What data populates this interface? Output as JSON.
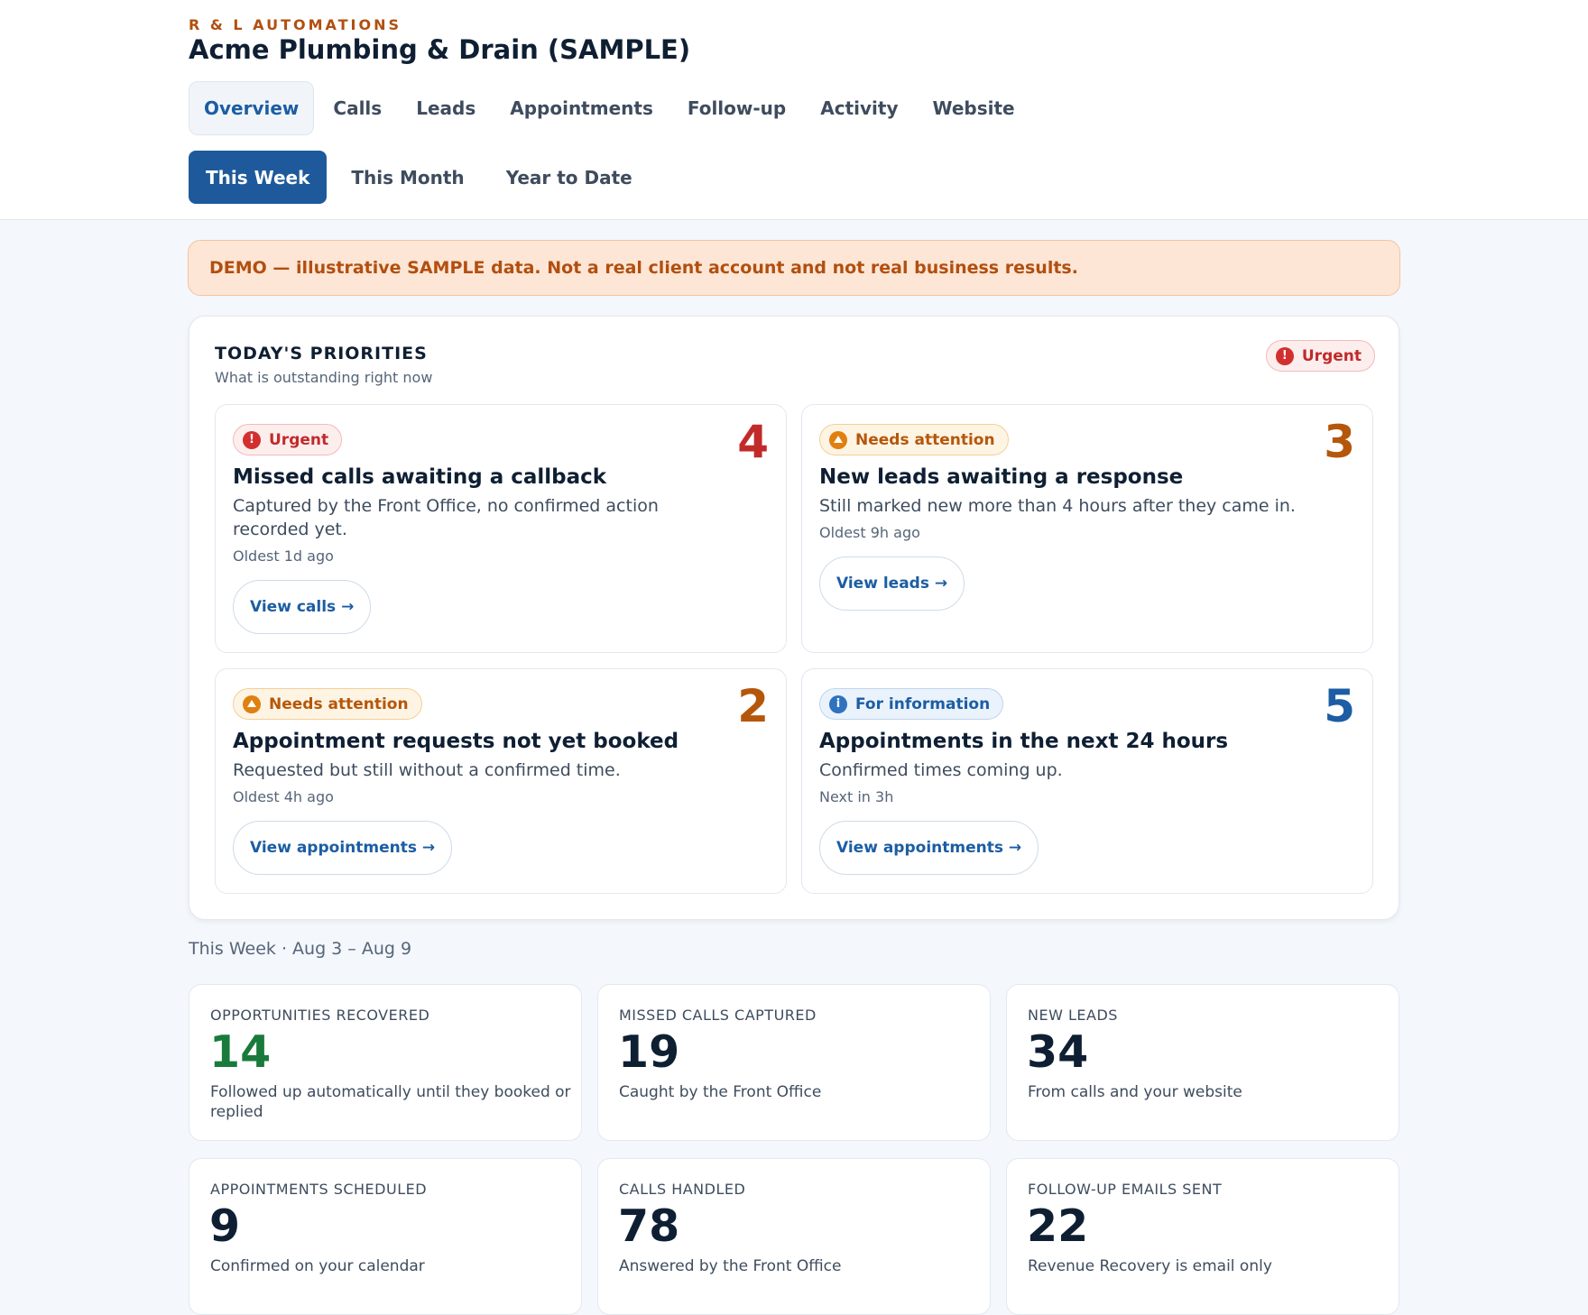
{
  "header": {
    "brand": "R & L AUTOMATIONS",
    "client": "Acme Plumbing & Drain (SAMPLE)",
    "tabs": [
      {
        "label": "Overview",
        "active": true
      },
      {
        "label": "Calls"
      },
      {
        "label": "Leads"
      },
      {
        "label": "Appointments"
      },
      {
        "label": "Follow-up"
      },
      {
        "label": "Activity"
      },
      {
        "label": "Website"
      }
    ],
    "ranges": [
      {
        "label": "This Week",
        "active": true
      },
      {
        "label": "This Month"
      },
      {
        "label": "Year to Date"
      }
    ]
  },
  "demo_banner": "DEMO — illustrative SAMPLE data. Not a real client account and not real business results.",
  "priorities": {
    "title": "TODAY'S PRIORITIES",
    "subtitle": "What is outstanding right now",
    "badge": "Urgent",
    "cards": [
      {
        "badge": "Urgent",
        "count": "4",
        "title": "Missed calls awaiting a callback",
        "desc": "Captured by the Front Office, no confirmed action recorded yet.",
        "meta": "Oldest 1d ago",
        "button": "View calls →"
      },
      {
        "badge": "Needs attention",
        "count": "3",
        "title": "New leads awaiting a response",
        "desc": "Still marked new more than 4 hours after they came in.",
        "meta": "Oldest 9h ago",
        "button": "View leads →"
      },
      {
        "badge": "Needs attention",
        "count": "2",
        "title": "Appointment requests not yet booked",
        "desc": "Requested but still without a confirmed time.",
        "meta": "Oldest 4h ago",
        "button": "View appointments →"
      },
      {
        "badge": "For information",
        "count": "5",
        "title": "Appointments in the next 24 hours",
        "desc": "Confirmed times coming up.",
        "meta": "Next in 3h",
        "button": "View appointments →"
      }
    ]
  },
  "period": "This Week · Aug 3 – Aug 9",
  "stats": [
    {
      "label": "OPPORTUNITIES RECOVERED",
      "value": "14",
      "desc": "Followed up automatically until they booked or replied"
    },
    {
      "label": "MISSED CALLS CAPTURED",
      "value": "19",
      "desc": "Caught by the Front Office"
    },
    {
      "label": "NEW LEADS",
      "value": "34",
      "desc": "From calls and your website"
    },
    {
      "label": "APPOINTMENTS SCHEDULED",
      "value": "9",
      "desc": "Confirmed on your calendar"
    },
    {
      "label": "CALLS HANDLED",
      "value": "78",
      "desc": "Answered by the Front Office"
    },
    {
      "label": "FOLLOW-UP EMAILS SENT",
      "value": "22",
      "desc": "Revenue Recovery is email only"
    }
  ],
  "colors": {
    "brand": "#b24f0f",
    "primary": "#1e5a9b",
    "urgent": "#c22a2a",
    "attention": "#b5570a",
    "info": "#1c5da3",
    "success": "#1a7a3c"
  },
  "icons": {
    "urgent": "exclamation-circle-icon",
    "attention": "warning-triangle-icon",
    "info": "info-circle-icon"
  }
}
